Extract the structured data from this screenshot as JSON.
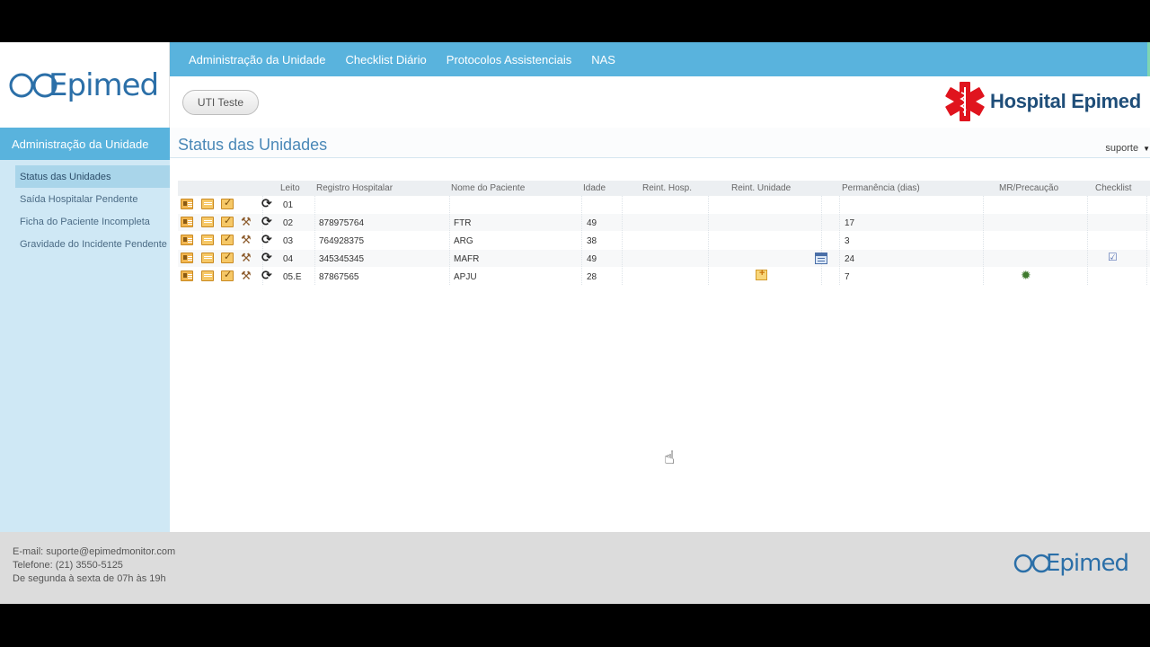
{
  "brand": {
    "logo_text": "Epimed",
    "hospital_name": "Hospital Epimed"
  },
  "topnav": {
    "items": [
      "Administração da Unidade",
      "Checklist Diário",
      "Protocolos Assistenciais",
      "NAS"
    ]
  },
  "unit_button": "UTI Teste",
  "sidebar": {
    "title": "Administração da Unidade",
    "items": [
      "Status das Unidades",
      "Saída Hospitalar Pendente",
      "Ficha do Paciente Incompleta",
      "Gravidade do Incidente Pendente"
    ],
    "active_index": 0
  },
  "page": {
    "title": "Status das Unidades",
    "user": "suporte"
  },
  "table": {
    "headers": {
      "leito": "Leito",
      "registro": "Registro Hospitalar",
      "nome": "Nome do Paciente",
      "idade": "Idade",
      "reint_hosp": "Reint. Hosp.",
      "reint_unidade": "Reint. Unidade",
      "permanencia": "Permanência (dias)",
      "mr": "MR/Precaução",
      "checklist": "Checklist"
    },
    "rows": [
      {
        "leito": "01",
        "registro": "",
        "nome": "",
        "idade": "",
        "permanencia": "",
        "hammer": false,
        "reint_unidade_icon": false,
        "calendar_icon": false,
        "mr_icon": false,
        "checklist_icon": false
      },
      {
        "leito": "02",
        "registro": "878975764",
        "nome": "FTR",
        "idade": "49",
        "permanencia": "17",
        "hammer": true,
        "reint_unidade_icon": false,
        "calendar_icon": false,
        "mr_icon": false,
        "checklist_icon": false
      },
      {
        "leito": "03",
        "registro": "764928375",
        "nome": "ARG",
        "idade": "38",
        "permanencia": "3",
        "hammer": true,
        "reint_unidade_icon": false,
        "calendar_icon": false,
        "mr_icon": false,
        "checklist_icon": false
      },
      {
        "leito": "04",
        "registro": "345345345",
        "nome": "MAFR",
        "idade": "49",
        "permanencia": "24",
        "hammer": true,
        "reint_unidade_icon": false,
        "calendar_icon": true,
        "mr_icon": false,
        "checklist_icon": true
      },
      {
        "leito": "05.E",
        "registro": "87867565",
        "nome": "APJU",
        "idade": "28",
        "permanencia": "7",
        "hammer": true,
        "reint_unidade_icon": true,
        "calendar_icon": false,
        "mr_icon": true,
        "checklist_icon": false
      }
    ]
  },
  "footer": {
    "email": "E-mail: suporte@epimedmonitor.com",
    "phone": "Telefone: (21) 3550-5125",
    "hours": "De segunda à sexta de 07h às 19h"
  },
  "colors": {
    "nav_blue": "#59b3dd",
    "sidebar_bg": "#cfe8f5",
    "title_blue": "#4a88b7",
    "logo_blue": "#2b6fa8",
    "cross_red": "#e0141e"
  }
}
